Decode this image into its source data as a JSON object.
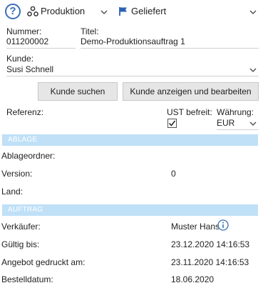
{
  "header": {
    "type_value": "Produktion",
    "status_value": "Geliefert"
  },
  "fields": {
    "nummer_label": "Nummer:",
    "nummer_value": "011200002",
    "titel_label": "Titel:",
    "titel_value": "Demo-Produktionsauftrag 1",
    "kunde_label": "Kunde:",
    "kunde_value": "Susi Schnell"
  },
  "buttons": {
    "kunde_suchen": "Kunde suchen",
    "kunde_anzeigen": "Kunde anzeigen und bearbeiten"
  },
  "options": {
    "referenz_label": "Referenz:",
    "ust_label": "UST befreit:",
    "ust_checked": true,
    "waehrung_label": "Währung:",
    "waehrung_value": "EUR"
  },
  "ablage": {
    "title": "ABLAGE",
    "ordner_label": "Ablageordner:",
    "version_label": "Version:",
    "version_value": "0",
    "land_label": "Land:"
  },
  "auftrag": {
    "title": "AUFTRAG",
    "verkaeufer_label": "Verkäufer:",
    "verkaeufer_value": "Muster Hans",
    "gueltig_label": "Gültig bis:",
    "gueltig_value": "23.12.2020 14:16:53",
    "gedruckt_label": "Angebot gedruckt am:",
    "gedruckt_value": "23.11.2020 14:16:53",
    "bestell_label": "Bestelldatum:",
    "bestell_value": "18.06.2020"
  },
  "colors": {
    "section_bar": "#bfe0f7",
    "help_icon": "#3b6fb6",
    "status_flag": "#2b62b3"
  },
  "icons": {
    "help": "question-circle-icon",
    "type": "production-nodes-icon",
    "status": "flag-icon",
    "info": "info-circle-icon",
    "dropdown": "chevron-down-icon"
  }
}
